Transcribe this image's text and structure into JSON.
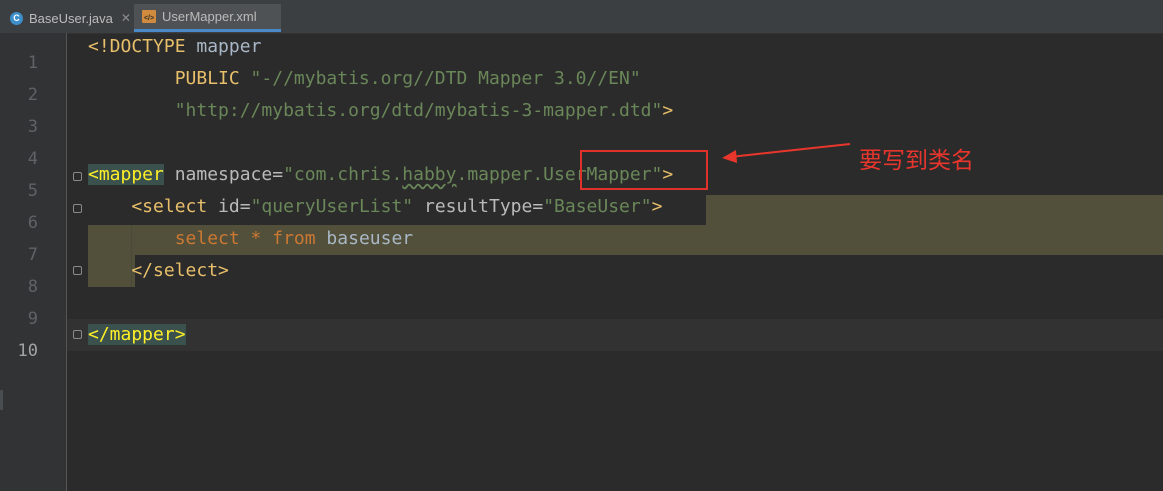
{
  "tabs": [
    {
      "label": "BaseUser.java",
      "icon": "java-class-icon",
      "close": "✕",
      "active": false
    },
    {
      "label": "UserMapper.xml",
      "icon": "xml-file-icon",
      "close": "",
      "active": true
    }
  ],
  "editor": {
    "line_numbers": [
      "1",
      "2",
      "3",
      "4",
      "5",
      "6",
      "7",
      "8",
      "9",
      "10"
    ],
    "current_line": "10",
    "lines": {
      "l1": {
        "t1": "<!DOCTYPE",
        "t2": " mapper"
      },
      "l2": {
        "t1": "        PUBLIC",
        "t2": " \"-//mybatis.org//DTD Mapper 3.0//EN\""
      },
      "l3": {
        "t1": "        \"http://mybatis.org/dtd/mybatis-3-mapper.dtd\"",
        "t2": ">"
      },
      "l5": {
        "t1": "<mapper",
        "t2": " namespace",
        "t3": "=",
        "t4": "\"com.chris.",
        "t5": "habby",
        "t6": ".mapper.UserMapper\"",
        "t7": ">"
      },
      "l6": {
        "t1": "    <select",
        "t2": " id",
        "t3": "=",
        "t4": "\"queryUserList\"",
        "t5": " resultType",
        "t6": "=",
        "t7": "\"BaseUser\"",
        "t8": ">"
      },
      "l7": {
        "t1": "        select",
        "t2": " * ",
        "t3": "from",
        "t4": " baseuser"
      },
      "l8": {
        "t1": "    </select>"
      },
      "l10": {
        "t1": "</mapper>"
      }
    }
  },
  "annotation": {
    "text": "要写到类名",
    "color": "#e8362d"
  },
  "colors": {
    "background": "#2b2b2b",
    "tag": "#e8bf6a",
    "string": "#6a8759",
    "keyword": "#cc7832",
    "highlight": "#52503a"
  }
}
